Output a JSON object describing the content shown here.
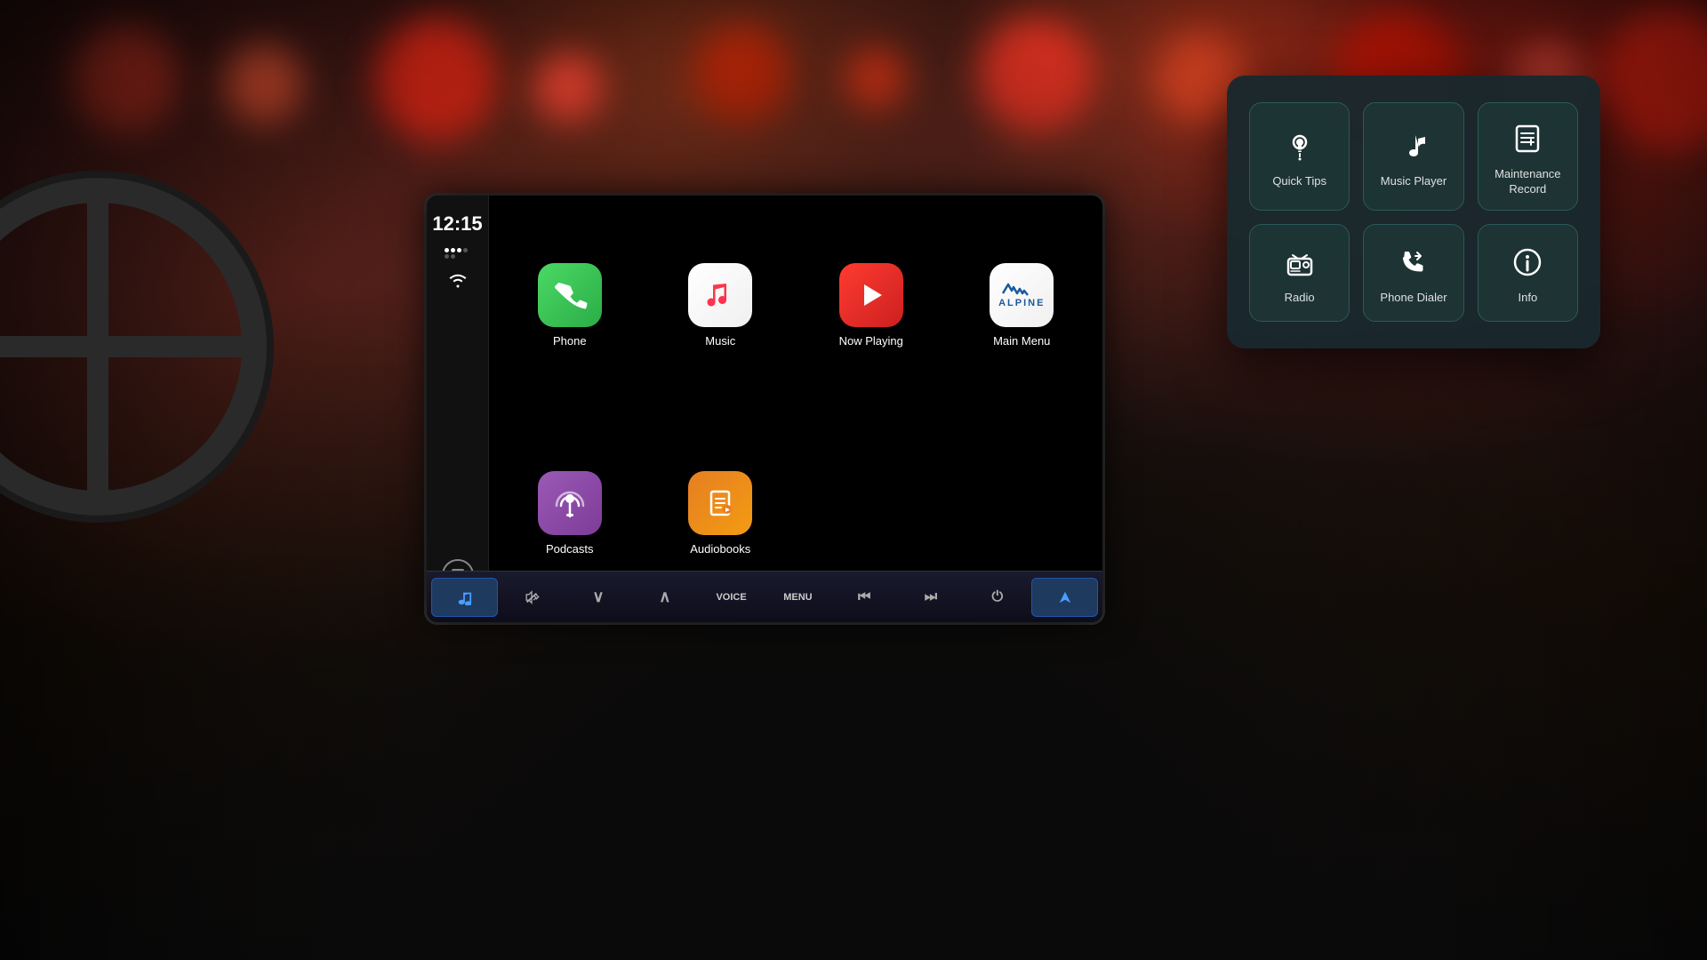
{
  "background": {
    "bokeh_colors": [
      "#cc3322",
      "#ee5533",
      "#ff8822",
      "#dd2211",
      "#ff4433",
      "#cc2200"
    ]
  },
  "screen": {
    "time": "12:15",
    "apps": [
      {
        "id": "phone",
        "label": "Phone",
        "color_class": "phone-icon",
        "icon_char": "📞"
      },
      {
        "id": "music",
        "label": "Music",
        "color_class": "music-icon",
        "icon_char": "🎵"
      },
      {
        "id": "now-playing",
        "label": "Now Playing",
        "color_class": "now-playing-icon",
        "icon_char": "▶"
      },
      {
        "id": "main-menu",
        "label": "Main Menu",
        "color_class": "main-menu-icon",
        "icon_char": "ALPINE"
      },
      {
        "id": "podcasts",
        "label": "Podcasts",
        "color_class": "podcasts-icon",
        "icon_char": "🎙"
      },
      {
        "id": "audiobooks",
        "label": "Audiobooks",
        "color_class": "audiobooks-icon",
        "icon_char": "📖"
      }
    ],
    "controls": [
      {
        "id": "music-ctrl",
        "label": "♪",
        "active": true
      },
      {
        "id": "mute",
        "label": "🔇",
        "active": false
      },
      {
        "id": "down",
        "label": "∨",
        "active": false
      },
      {
        "id": "up",
        "label": "∧",
        "active": false
      },
      {
        "id": "voice",
        "label": "VOICE",
        "active": false
      },
      {
        "id": "menu",
        "label": "MENU",
        "active": false
      },
      {
        "id": "prev",
        "label": "⏮",
        "active": false
      },
      {
        "id": "next",
        "label": "⏭",
        "active": false
      },
      {
        "id": "power",
        "label": "⏻",
        "active": false
      },
      {
        "id": "nav",
        "label": "▲",
        "active": true
      }
    ]
  },
  "popup": {
    "items": [
      {
        "id": "quick-tips",
        "label": "Quick Tips",
        "icon": "💡"
      },
      {
        "id": "music-player",
        "label": "Music Player",
        "icon": "♪"
      },
      {
        "id": "maintenance-record",
        "label": "Maintenance Record",
        "icon": "🔧"
      },
      {
        "id": "radio",
        "label": "Radio",
        "icon": "📻"
      },
      {
        "id": "phone-dialer",
        "label": "Phone Dialer",
        "icon": "📞"
      },
      {
        "id": "info",
        "label": "Info",
        "icon": "ℹ"
      }
    ]
  }
}
